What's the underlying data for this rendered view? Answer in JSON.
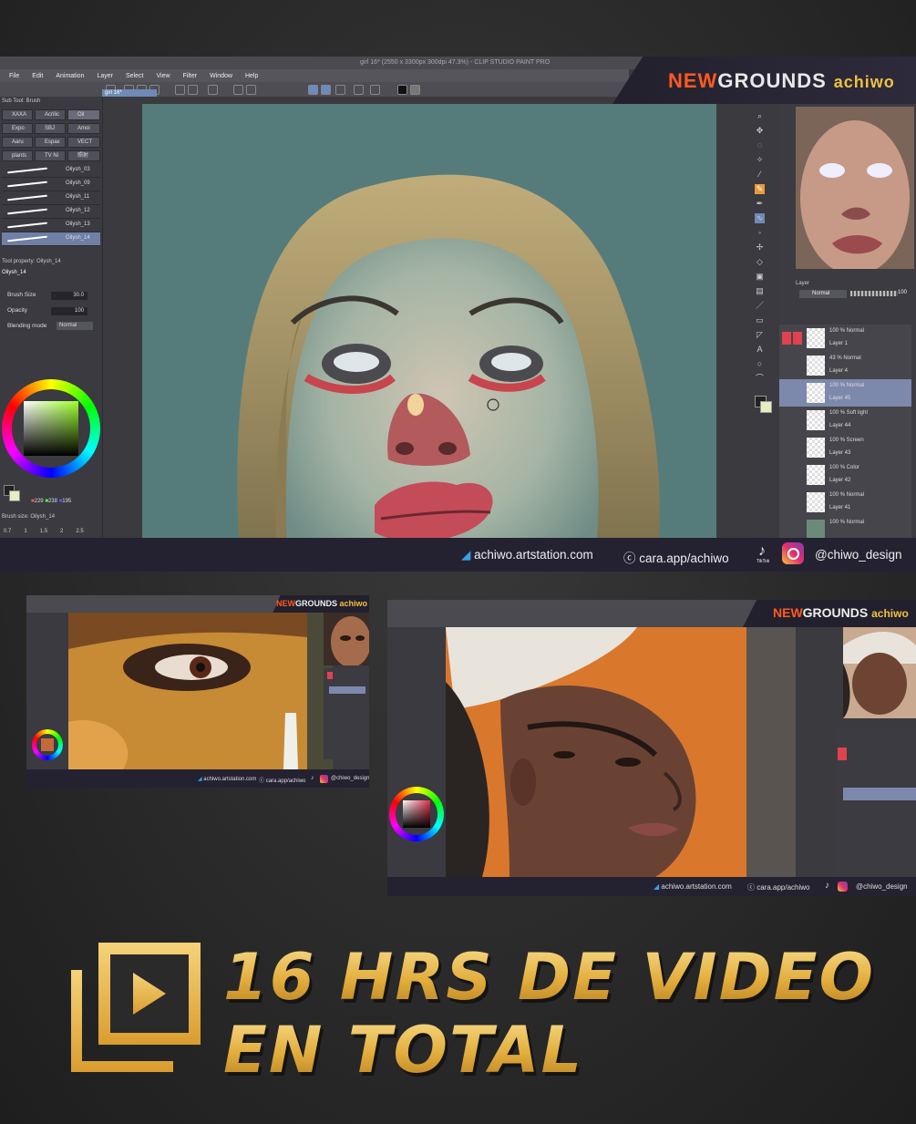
{
  "main_window": {
    "title": "girl 16* (2550 x 3300px 300dpi 47.3%) - CLIP STUDIO PAINT PRO",
    "menu": [
      "File",
      "Edit",
      "Animation",
      "Layer",
      "Select",
      "View",
      "Filter",
      "Window",
      "Help"
    ],
    "tab": "girl 16*",
    "sub_tool_header": "Sub Tool: Brush",
    "brush_buttons": [
      "XAXA",
      "Acrilic",
      "Oil",
      "Expo",
      "SBJ",
      "Amoi",
      "Aaru",
      "Espax",
      "VECT",
      "plants",
      "TV Ni",
      "照射"
    ],
    "brush_strokes": [
      "Oilysh_03",
      "Oilysh_09",
      "Oilysh_11",
      "Oilysh_12",
      "Oilysh_13",
      "Oilysh_14"
    ],
    "tool_property_header": "Tool property: Oilysh_14",
    "tool_property_brush": "Oilysh_14",
    "brush_size_label": "Brush Size",
    "brush_size_value": "30.0",
    "opacity_label": "Opacity",
    "opacity_value": "100",
    "blending_label": "Blending mode",
    "blending_value": "Normal",
    "rgb": [
      "229",
      "238",
      "195"
    ],
    "brush_size_footer": "Brush size: Oilysh_14",
    "size_ticks": [
      "0.7",
      "1",
      "1.5",
      "2",
      "2.5"
    ],
    "layer_panel_header": "Layer",
    "layer_mode": "Normal",
    "layer_opacity": "100",
    "layers": [
      {
        "mode": "100 % Normal",
        "name": "Layer 1"
      },
      {
        "mode": "43 % Normal",
        "name": "Layer 4"
      },
      {
        "mode": "100 % Normal",
        "name": "Layer 45"
      },
      {
        "mode": "100 % Soft light",
        "name": "Layer 44"
      },
      {
        "mode": "100 % Screen",
        "name": "Layer 43"
      },
      {
        "mode": "100 % Color",
        "name": "Layer 42"
      },
      {
        "mode": "100 % Normal",
        "name": "Layer 41"
      },
      {
        "mode": "100 % Normal",
        "name": ""
      }
    ]
  },
  "brand": {
    "ng_part1": "NEW",
    "ng_part2": "GROUNDS",
    "author": "achiwo"
  },
  "links": {
    "artstation": "achiwo.artstation.com",
    "cara": "cara.app/achiwo",
    "tiktok_label": "TikTok",
    "social": "@chiwo_design"
  },
  "promo": {
    "line1": "16 HRS DE VIDEO",
    "line2": "EN TOTAL"
  },
  "colors": {
    "accent_gold": "#e8b94a",
    "ng_orange": "#ff5a1f",
    "bar_bg": "#242231"
  },
  "icons": [
    "artstation-icon",
    "cara-icon",
    "tiktok-icon",
    "instagram-icon",
    "play-video-icon"
  ]
}
